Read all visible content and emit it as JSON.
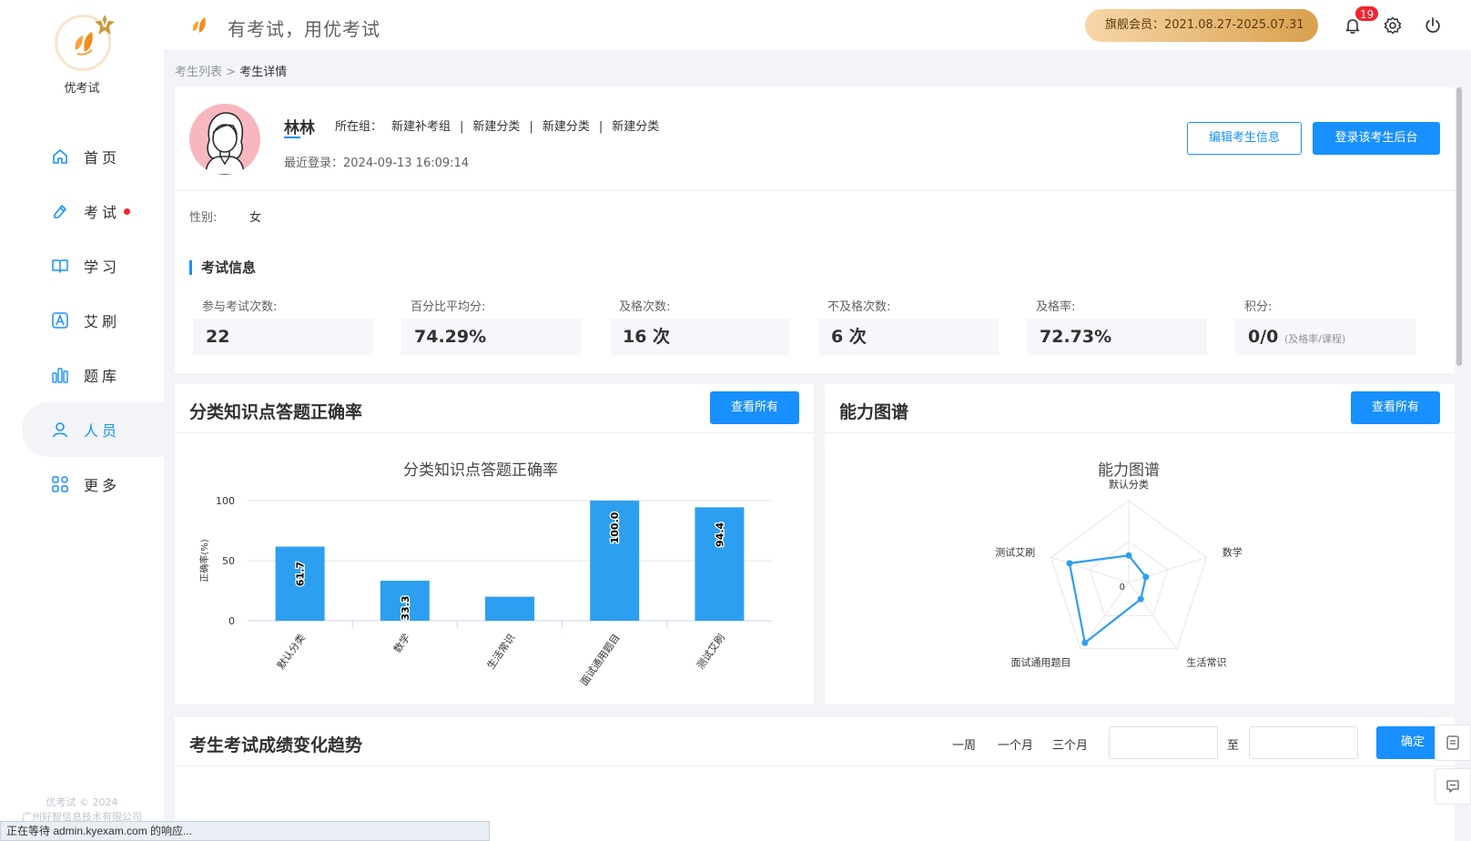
{
  "sidebar": {
    "logo_text": "优考试",
    "vip_badge": "V",
    "items": [
      {
        "label": "首页",
        "icon": "home-icon"
      },
      {
        "label": "考试",
        "icon": "exam-icon"
      },
      {
        "label": "学习",
        "icon": "book-icon"
      },
      {
        "label": "艾刷",
        "icon": "a-icon"
      },
      {
        "label": "题库",
        "icon": "bars-icon"
      },
      {
        "label": "人员",
        "icon": "user-icon"
      },
      {
        "label": "更多",
        "icon": "grid-icon"
      }
    ],
    "footer_line1": "优考试 © 2024",
    "footer_line2": "广州好智信息技术有限公司"
  },
  "header": {
    "slogan": "有考试，用优考试",
    "member": "旗舰会员：2021.08.27-2025.07.31",
    "notification_count": "19"
  },
  "breadcrumb": {
    "parent": "考生列表",
    "sep": " > ",
    "current": "考生详情"
  },
  "profile": {
    "name": "林林",
    "groups_label": "所在组：",
    "groups": [
      "新建补考组",
      "|",
      "新建分类",
      "|",
      "新建分类",
      "|",
      "新建分类"
    ],
    "last_login": "最近登录：2024-09-13 16:09:14",
    "edit_button": "编辑考生信息",
    "login_button": "登录该考生后台",
    "gender_label": "性别:",
    "gender_value": "女"
  },
  "exam_info": {
    "title": "考试信息",
    "stats": [
      {
        "label": "参与考试次数:",
        "value": "22"
      },
      {
        "label": "百分比平均分:",
        "value": "74.29%"
      },
      {
        "label": "及格次数:",
        "value": "16 次"
      },
      {
        "label": "不及格次数:",
        "value": "6 次"
      },
      {
        "label": "及格率:",
        "value": "72.73%"
      },
      {
        "label": "积分:",
        "value": "0/0",
        "note": "(及格率/课程)"
      }
    ]
  },
  "bar_panel": {
    "title": "分类知识点答题正确率",
    "button": "查看所有"
  },
  "radar_panel": {
    "title": "能力图谱",
    "button": "查看所有"
  },
  "trend": {
    "title": "考生考试成绩变化趋势",
    "ranges": [
      "一周",
      "一个月",
      "三个月"
    ],
    "to_label": "至",
    "confirm": "确定"
  },
  "status_bar": "正在等待 admin.kyexam.com 的响应...",
  "colors": {
    "primary": "#1890ff",
    "bar": "#2d9ff0",
    "gold_start": "#f7d6a8",
    "gold_end": "#d9a04c"
  },
  "chart_data": [
    {
      "type": "bar",
      "title": "分类知识点答题正确率",
      "ylabel": "正确率(%)",
      "categories": [
        "默认分类",
        "数学",
        "生活常识",
        "面试通用题目",
        "测试艾刷"
      ],
      "values": [
        61.7,
        33.3,
        20,
        100.0,
        94.4
      ],
      "data_labels": [
        "61.7",
        "33.3",
        "",
        "100.0",
        "94.4"
      ],
      "yticks": [
        "0",
        "50",
        "100"
      ],
      "ylim": [
        0,
        100
      ]
    },
    {
      "type": "radar",
      "title": "能力图谱",
      "categories": [
        "默认分类",
        "数学",
        "生活常识",
        "面试通用题目",
        "测试艾刷"
      ],
      "values": [
        33,
        22,
        25,
        91,
        76
      ],
      "center_label": "0",
      "max": 100
    }
  ]
}
